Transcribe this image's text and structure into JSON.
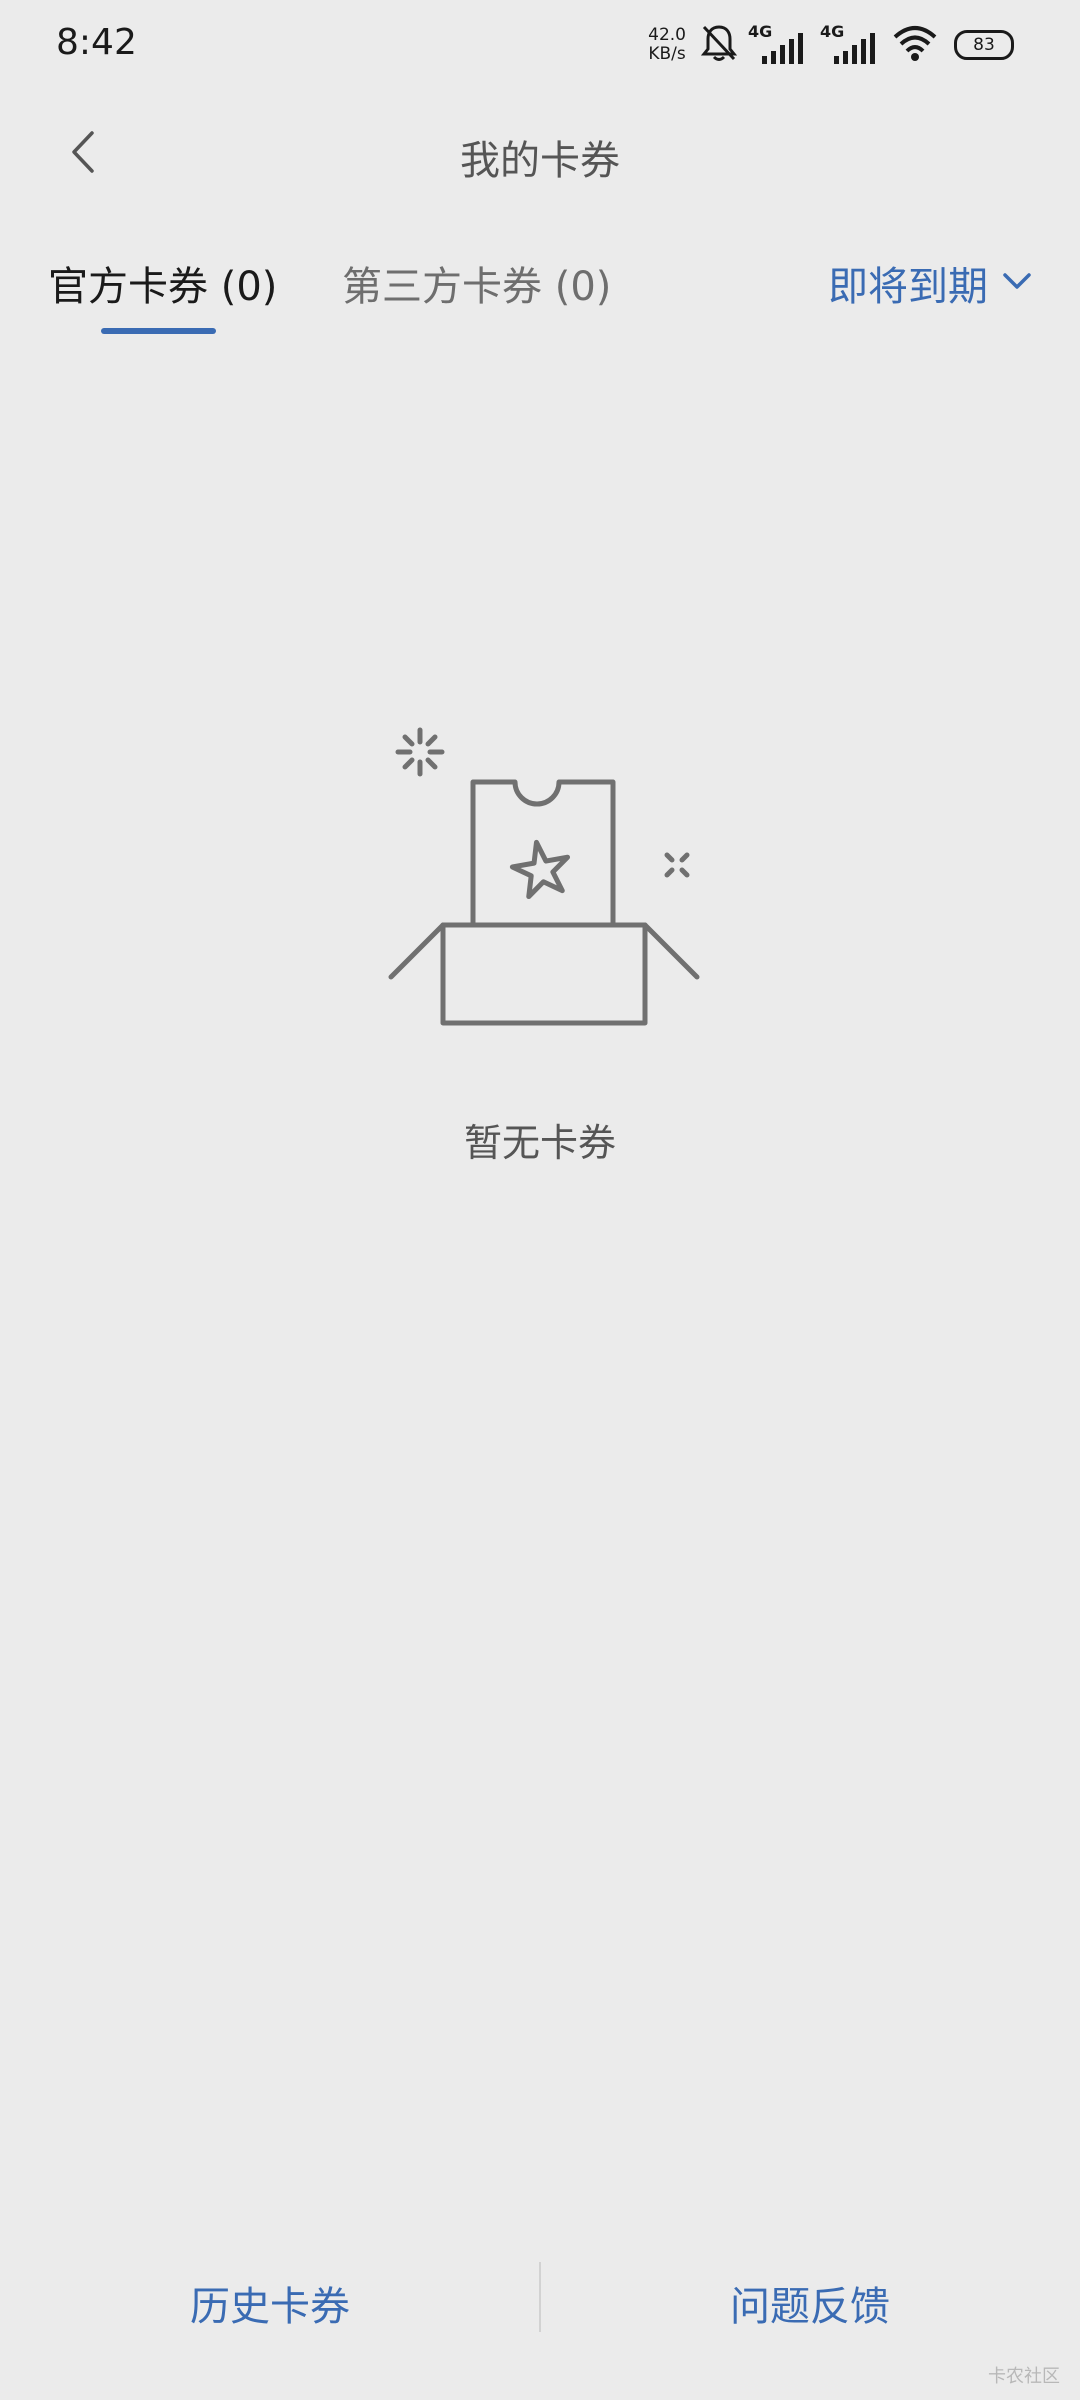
{
  "status_bar": {
    "time": "8:42",
    "net_speed_value": "42.0",
    "net_speed_unit": "KB/s",
    "sim1_label": "4G",
    "sim2_label": "4G",
    "battery": "83",
    "icons": [
      "bell-muted-icon",
      "signal-icon",
      "signal-icon",
      "wifi-icon",
      "battery-icon"
    ]
  },
  "header": {
    "title": "我的卡券",
    "back_icon": "back-chevron-icon"
  },
  "tabs": [
    {
      "label": "官方卡券 (0)",
      "active": true
    },
    {
      "label": "第三方卡券 (0)",
      "active": false
    }
  ],
  "sort": {
    "label": "即将到期",
    "icon": "chevron-down-icon"
  },
  "empty_state": {
    "illustration": "empty-box-ticket-icon",
    "text": "暂无卡券"
  },
  "bottom_bar": {
    "history_label": "历史卡券",
    "feedback_label": "问题反馈"
  },
  "watermark": "卡农社区",
  "colors": {
    "accent": "#3a6bb3",
    "background": "#ebebeb",
    "text_primary": "#1a1a1a",
    "text_secondary": "#6e6e6e",
    "icon_gray": "#707070"
  }
}
